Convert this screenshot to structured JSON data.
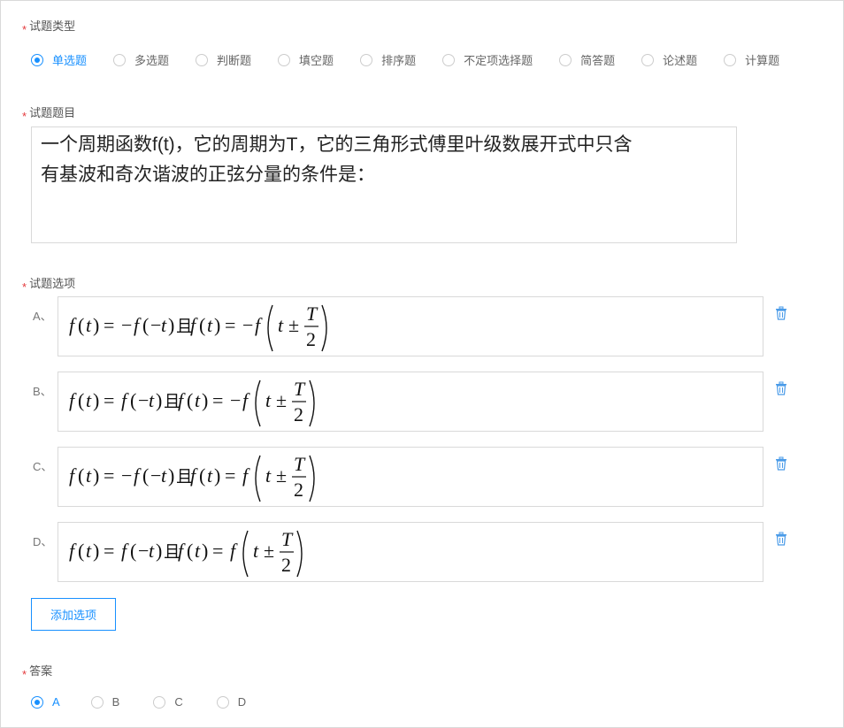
{
  "type_section": {
    "label": "试题类型",
    "options": [
      "单选题",
      "多选题",
      "判断题",
      "填空题",
      "排序题",
      "不定项选择题",
      "简答题",
      "论述题",
      "计算题"
    ],
    "selected": "单选题"
  },
  "stem_section": {
    "label": "试题题目",
    "text_line1": "一个周期函数f(t)，它的周期为T，它的三角形式傅里叶级数展开式中只含",
    "text_line2": "有基波和奇次谐波的正弦分量的条件是："
  },
  "options_section": {
    "label": "试题选项",
    "items": [
      {
        "letter": "A、",
        "lhs": "f(t) = −f(−t)",
        "joiner": "且",
        "rhs": "f(t) = −f(t ± T/2)"
      },
      {
        "letter": "B、",
        "lhs": "f(t) = f(−t)",
        "joiner": "且",
        "rhs": "f(t) = −f(t ± T/2)"
      },
      {
        "letter": "C、",
        "lhs": "f(t) = −f(−t)",
        "joiner": "且",
        "rhs": "f(t) = f(t ± T/2)"
      },
      {
        "letter": "D、",
        "lhs": "f(t) = f(−t)",
        "joiner": "且",
        "rhs": "f(t) = f(t ± T/2)"
      }
    ],
    "add_button": "添加选项"
  },
  "answer_section": {
    "label": "答案",
    "options": [
      "A",
      "B",
      "C",
      "D"
    ],
    "selected": "A"
  },
  "colors": {
    "accent": "#1890ff",
    "required": "#e4393c",
    "border": "#d9d9d9"
  },
  "icons": {
    "delete": "trash-icon"
  }
}
